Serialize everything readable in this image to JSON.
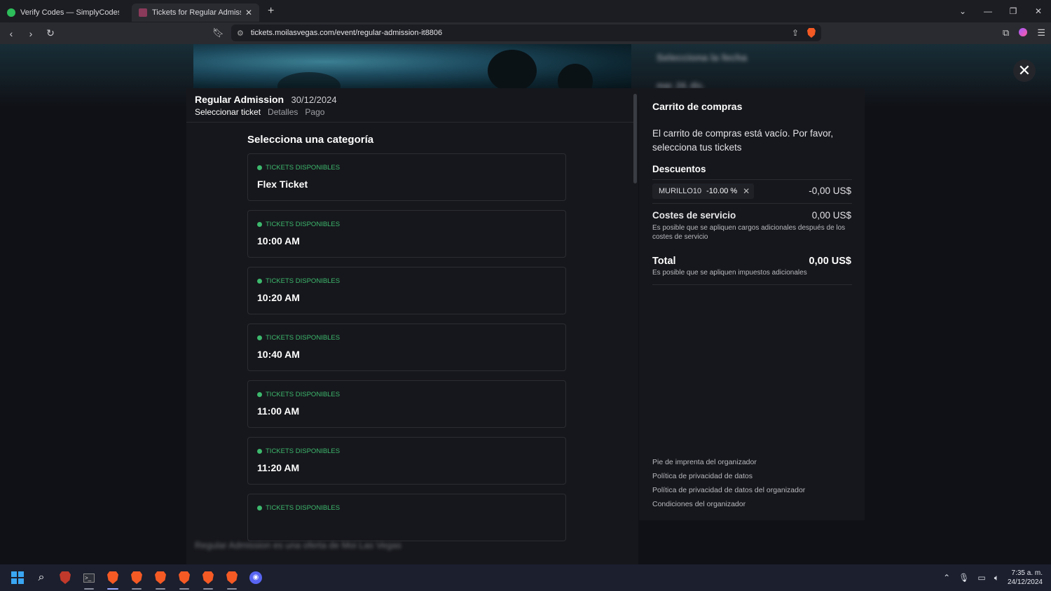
{
  "browser": {
    "tabs": [
      {
        "label": "Verify Codes — SimplyCodes",
        "active": false,
        "icon": "simplycodes-icon"
      },
      {
        "label": "Tickets for Regular Admission |",
        "active": true,
        "icon": "tickets-icon"
      }
    ],
    "url": "tickets.moilasvegas.com/event/regular-admission-it8806"
  },
  "background": {
    "blurred_header": "Selecciona la fecha",
    "blurred_date": "mar. 24. dic.",
    "blurred_footer": "Regular Admission es una oferta de Moi Las Vegas"
  },
  "event": {
    "title": "Regular Admission",
    "date": "30/12/2024",
    "steps": [
      {
        "label": "Seleccionar ticket",
        "active": true
      },
      {
        "label": "Detalles",
        "active": false
      },
      {
        "label": "Pago",
        "active": false
      }
    ]
  },
  "categories": {
    "heading": "Selecciona una categoría",
    "items": [
      {
        "status": "TICKETS DISPONIBLES",
        "name": "Flex Ticket"
      },
      {
        "status": "TICKETS DISPONIBLES",
        "name": "10:00 AM"
      },
      {
        "status": "TICKETS DISPONIBLES",
        "name": "10:20 AM"
      },
      {
        "status": "TICKETS DISPONIBLES",
        "name": "10:40 AM"
      },
      {
        "status": "TICKETS DISPONIBLES",
        "name": "11:00 AM"
      },
      {
        "status": "TICKETS DISPONIBLES",
        "name": "11:20 AM"
      },
      {
        "status": "TICKETS DISPONIBLES",
        "name": ""
      }
    ]
  },
  "cart": {
    "title": "Carrito de compras",
    "empty_message": "El carrito de compras está vacío. Por favor, selecciona tus tickets",
    "discounts_title": "Descuentos",
    "coupon_code": "MURILLO10",
    "coupon_percent": "-10.00 %",
    "discount_amount": "-0,00 US$",
    "service_title": "Costes de servicio",
    "service_amount": "0,00 US$",
    "service_note": "Es posible que se apliquen cargos adicionales después de los costes de servicio",
    "total_title": "Total",
    "total_amount": "0,00 US$",
    "total_note": "Es posible que se apliquen impuestos adicionales",
    "links": [
      "Pie de imprenta del organizador",
      "Política de privacidad de datos",
      "Política de privacidad de datos del organizador",
      "Condiciones del organizador"
    ]
  },
  "taskbar": {
    "time": "7:35 a. m.",
    "date": "24/12/2024"
  },
  "colors": {
    "available_green": "#3db96d",
    "panel_bg": "#16171c",
    "page_bg": "#101116"
  }
}
